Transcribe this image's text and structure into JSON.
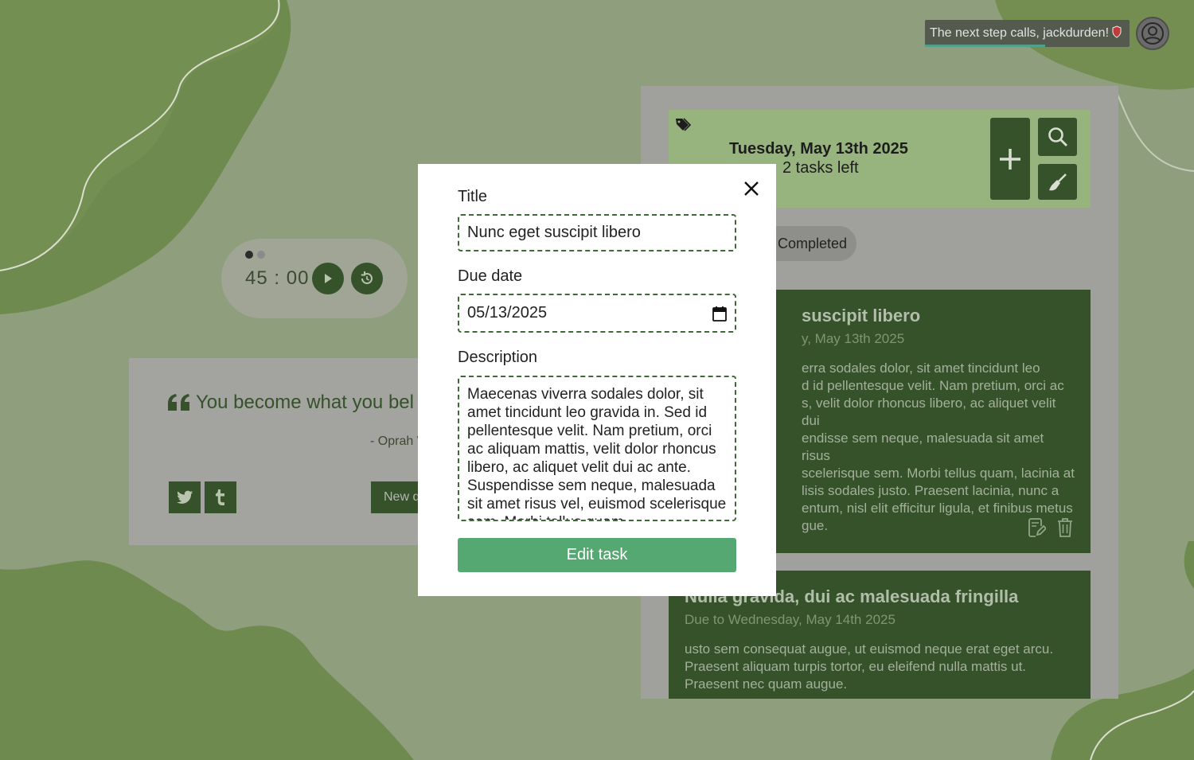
{
  "header": {
    "greeting": "The next step calls, jackdurden!",
    "avatar_icon": "user-circle-icon",
    "shield_icon": "shield-icon"
  },
  "timer": {
    "minutes": "45",
    "separator": ":",
    "seconds": "00",
    "play_icon": "play-icon",
    "reset_icon": "reset-icon"
  },
  "quote": {
    "text": "You become what you bel",
    "author": "- Oprah W",
    "new_quote_label": "New q",
    "twitter_icon": "twitter-icon",
    "tumblr_icon": "tumblr-icon"
  },
  "tasks": {
    "date": "Tuesday, May 13th 2025",
    "tasks_left": "2 tasks left",
    "filter_completed": "Completed",
    "items": [
      {
        "title": "suscipit libero",
        "due": "y, May 13th 2025",
        "desc": "erra sodales dolor, sit amet tincidunt leo\nd id pellentesque velit. Nam pretium, orci ac\ns, velit dolor rhoncus libero, ac aliquet velit dui\nendisse sem neque, malesuada sit amet risus\nscelerisque sem. Morbi tellus quam, lacinia at\nlisis sodales justo. Praesent lacinia, nunc a\nentum, nisl elit efficitur ligula, et finibus metus\ngue."
      },
      {
        "title": "Nulla gravida, dui ac malesuada fringilla",
        "due": "Due to Wednesday, May 14th 2025",
        "desc": "usto sem consequat augue, ut euismod neque erat eget arcu. Praesent aliquam turpis tortor, eu eleifend nulla mattis ut. Praesent nec quam augue."
      }
    ]
  },
  "modal": {
    "title_label": "Title",
    "title_value": "Nunc eget suscipit libero",
    "due_label": "Due date",
    "due_value": "05/13/2025",
    "desc_label": "Description",
    "desc_value": "Maecenas viverra sodales dolor, sit amet tincidunt leo gravida in. Sed id pellentesque velit. Nam pretium, orci ac aliquam mattis, velit dolor rhoncus libero, ac aliquet velit dui ac ante. Suspendisse sem neque, malesuada sit amet risus vel, euismod scelerisque sem. Morbi tellus quam,",
    "submit_label": "Edit task"
  },
  "colors": {
    "accent_dark": "#35522b",
    "submit": "#56a872",
    "field_border": "#3e6a35"
  }
}
